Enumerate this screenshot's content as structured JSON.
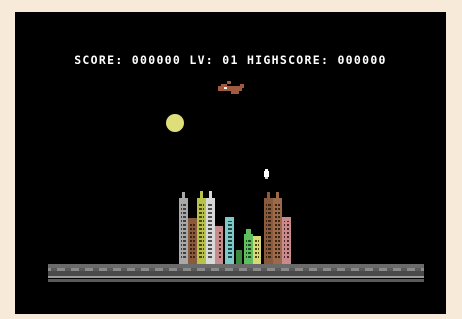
{
  "hud": {
    "score_label": "SCORE:",
    "score_value": "000000",
    "level_label": "LV:",
    "level_value": "01",
    "highscore_label": "HIGHSCORE:",
    "highscore_value": "000000"
  },
  "colors": {
    "border": "#f7ead9",
    "sky": "#000000",
    "hud_text": "#ffffff",
    "moon": "#dedf7a",
    "plane": "#a05a3f",
    "road": "#8a8a8a",
    "road_dark": "#4a4a4a"
  },
  "icons": {
    "plane": "bomber-plane-icon",
    "moon": "moon-icon",
    "bomb": "bomb-icon"
  }
}
